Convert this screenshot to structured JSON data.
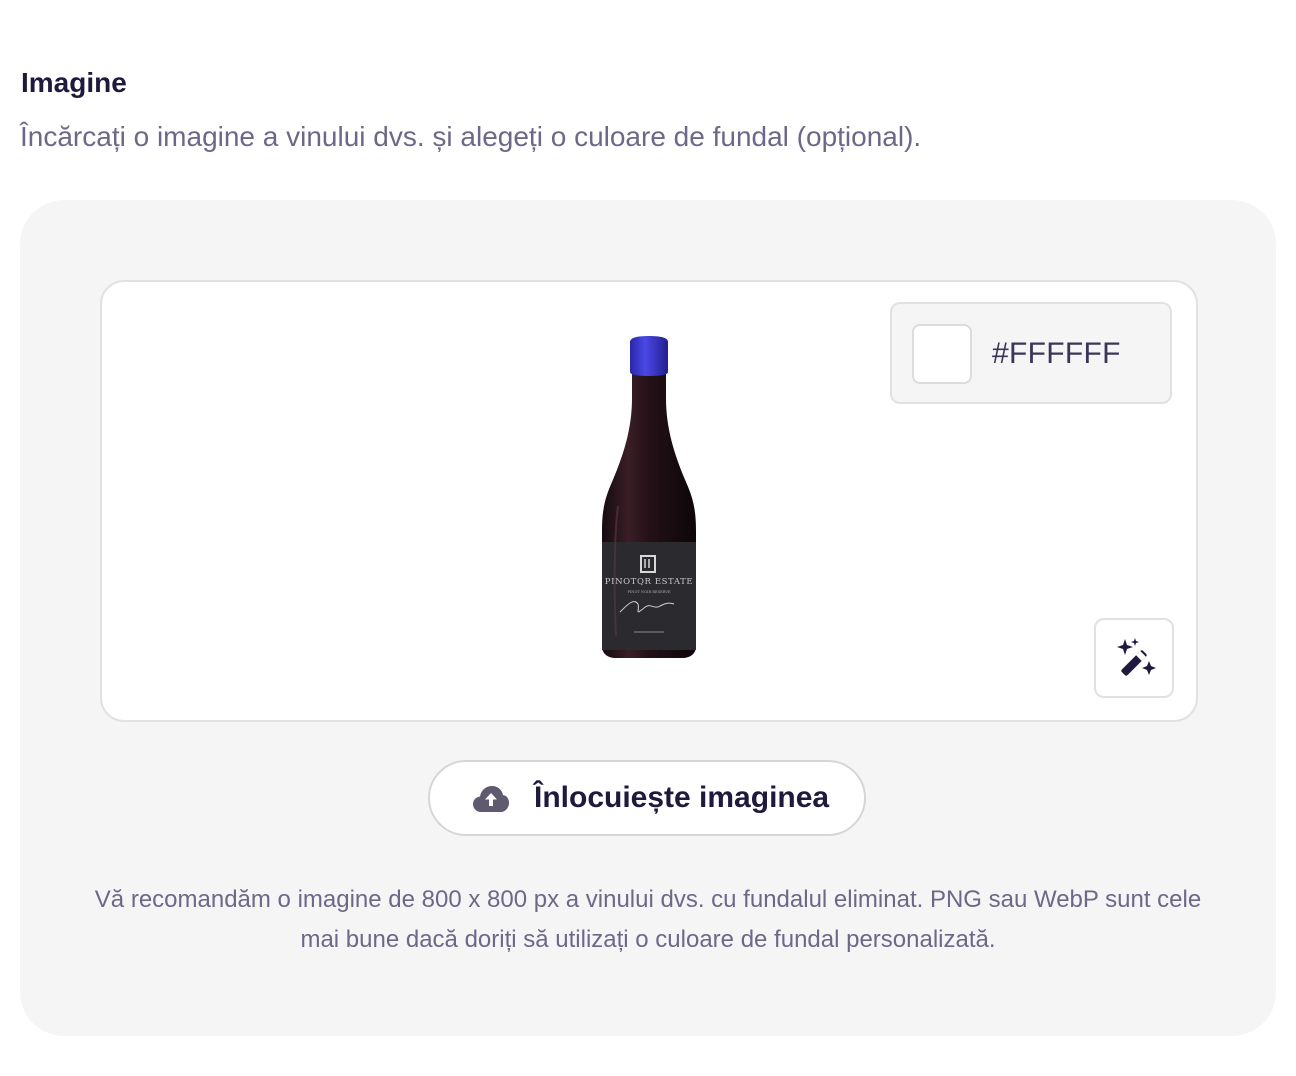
{
  "section": {
    "title": "Imagine",
    "description": "Încărcați o imagine a vinului dvs. și alegeți o culoare de fundal (opțional)."
  },
  "preview": {
    "background_color": "#FFFFFF",
    "bottle_label": {
      "brand": "PINOTQR ESTATE",
      "subtitle": "PINOT NOIR RESERVE"
    }
  },
  "color_picker": {
    "hex_value": "#FFFFFF",
    "swatch_color": "#FFFFFF"
  },
  "magic_button": {
    "icon": "magic-wand-sparkles-icon"
  },
  "replace_button": {
    "icon": "cloud-upload-icon",
    "label": "Înlocuiește imaginea"
  },
  "recommendation": {
    "text": "Vă recomandăm o imagine de 800 x 800 px a vinului dvs. cu fundalul eliminat. PNG sau WebP sunt cele mai bune dacă doriți să utilizați o culoare de fundal personalizată."
  },
  "colors": {
    "title": "#1F1A3D",
    "muted_text": "#6E6888",
    "panel_bg": "#F5F5F6",
    "border": "#E1E1E4",
    "bottle_cap": "#3A37C8"
  }
}
